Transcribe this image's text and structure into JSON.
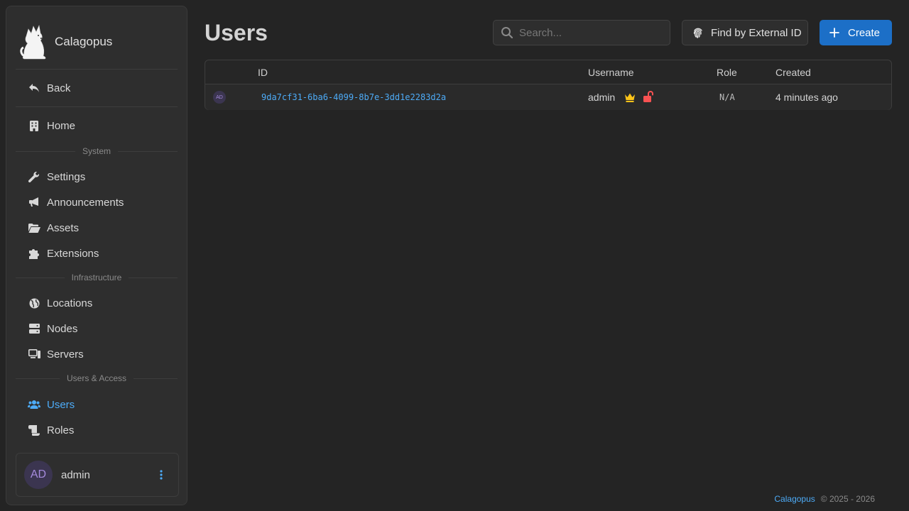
{
  "brand": {
    "name": "Calagopus"
  },
  "sidebar": {
    "back": "Back",
    "home": "Home",
    "sections": {
      "system": "System",
      "infrastructure": "Infrastructure",
      "users_access": "Users & Access"
    },
    "items": {
      "settings": "Settings",
      "announcements": "Announcements",
      "assets": "Assets",
      "extensions": "Extensions",
      "locations": "Locations",
      "nodes": "Nodes",
      "servers": "Servers",
      "users": "Users",
      "roles": "Roles"
    },
    "active_item": "Users",
    "user": {
      "initials": "AD",
      "name": "admin"
    }
  },
  "main": {
    "title": "Users",
    "search": {
      "placeholder": "Search...",
      "value": ""
    },
    "find_external_label": "Find by External ID",
    "create_label": "Create",
    "table": {
      "columns": [
        "",
        "ID",
        "Username",
        "Role",
        "Created"
      ],
      "rows": [
        {
          "avatar": "AD",
          "id": "9da7cf31-6ba6-4099-8b7e-3dd1e2283d2a",
          "username": "admin",
          "badges": [
            "crown-icon",
            "unlock-icon"
          ],
          "role": "N/A",
          "created": "4 minutes ago"
        }
      ]
    }
  },
  "footer": {
    "link": "Calagopus",
    "copyright": "© 2025 - 2026"
  },
  "colors": {
    "accent": "#4dabf7",
    "primary_button": "#1c6fc7",
    "crown": "#fcc419",
    "unlock": "#fa5252"
  }
}
